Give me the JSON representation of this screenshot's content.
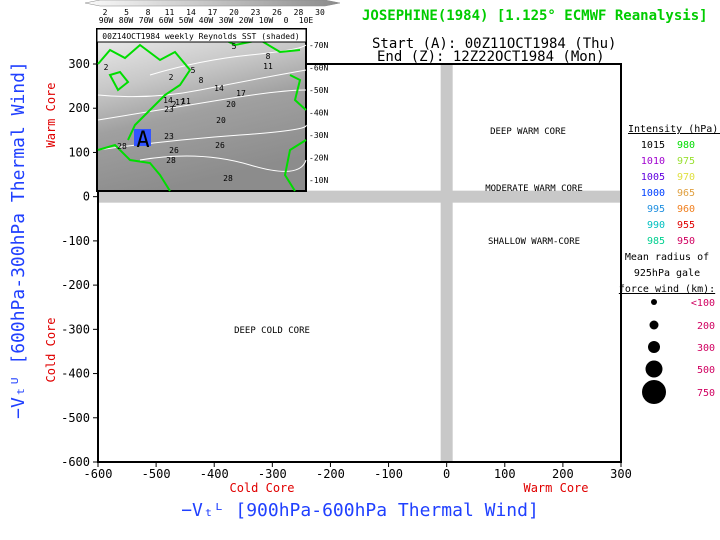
{
  "header": {
    "title": "JOSEPHINE(1984) [1.125° ECMWF Reanalysis]",
    "start": "Start (A): 00Z11OCT1984 (Thu)",
    "end": "End (Z): 12Z22OCT1984 (Mon)"
  },
  "inset": {
    "title": "00Z14OCT1984 weekly Reynolds SST (shaded)",
    "colorbar_ticks": [
      "2",
      "5",
      "8",
      "11",
      "14",
      "17",
      "20",
      "23",
      "26",
      "28",
      "30"
    ],
    "lon_labels": [
      "90W",
      "80W",
      "70W",
      "60W",
      "50W",
      "40W",
      "30W",
      "20W",
      "10W",
      "0",
      "10E"
    ],
    "lat_labels": [
      "70N",
      "60N",
      "50N",
      "40N",
      "30N",
      "20N",
      "10N"
    ],
    "contour_labels": [
      "2",
      "5",
      "2",
      "8",
      "11",
      "2",
      "5",
      "8",
      "14",
      "17",
      "14",
      "11",
      "20",
      "17",
      "23",
      "20",
      "23",
      "26",
      "28",
      "26",
      "28",
      "28",
      "28"
    ],
    "start_marker": "A",
    "colors": {
      "land": "#00dd00",
      "storm_box": "#3355ff"
    }
  },
  "chart_data": {
    "type": "scatter",
    "title": "",
    "xlabel": "-V_T^L [900hPa-600hPa Thermal Wind]",
    "ylabel": "-V_T^U [600hPa-300hPa Thermal Wind]",
    "xlim": [
      -600,
      300
    ],
    "ylim": [
      -600,
      300
    ],
    "xticks": [
      "-600",
      "-500",
      "-400",
      "-300",
      "-200",
      "-100",
      "0",
      "100",
      "200",
      "300"
    ],
    "yticks": [
      "300",
      "200",
      "100",
      "0",
      "-100",
      "-200",
      "-300",
      "-400",
      "-500",
      "-600"
    ],
    "x_side_labels": {
      "left": "Cold Core",
      "right": "Warm Core"
    },
    "y_side_labels": {
      "top": "Warm Core",
      "bottom": "Cold Core"
    },
    "annotations": [
      "DEEP WARM CORE",
      "MODERATE WARM CORE",
      "SHALLOW WARM-CORE",
      "DEEP COLD CORE"
    ],
    "zero_lines_color": "#c8c8c8",
    "series": []
  },
  "legend": {
    "intensity_title": "Intensity (hPa):",
    "intensity": [
      {
        "left": "1015",
        "lc": "#000000",
        "right": "980",
        "rc": "#00dd00"
      },
      {
        "left": "1010",
        "lc": "#a000d0",
        "right": "975",
        "rc": "#99e030"
      },
      {
        "left": "1005",
        "lc": "#6000e0",
        "right": "970",
        "rc": "#e0e040"
      },
      {
        "left": "1000",
        "lc": "#0040ff",
        "right": "965",
        "rc": "#e0a040"
      },
      {
        "left": "995",
        "lc": "#2090e0",
        "right": "960",
        "rc": "#f08020"
      },
      {
        "left": "990",
        "lc": "#00c0c0",
        "right": "955",
        "rc": "#e00000"
      },
      {
        "left": "985",
        "lc": "#00d090",
        "right": "950",
        "rc": "#d00060"
      }
    ],
    "radius_title": [
      "Mean radius of",
      "925hPa gale",
      "force wind (km):"
    ],
    "radius": [
      "<100",
      "200",
      "300",
      "500",
      "750"
    ],
    "radius_color": "#d00060"
  }
}
